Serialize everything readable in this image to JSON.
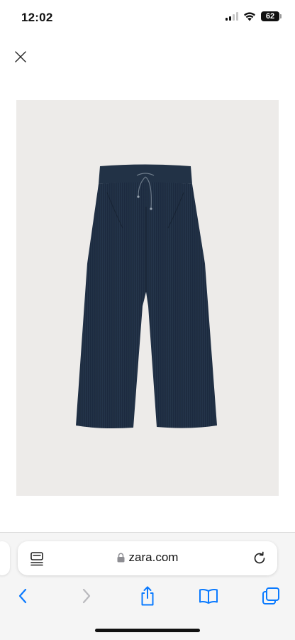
{
  "status_bar": {
    "time": "12:02",
    "battery_level": "62",
    "signal_bars_active": 2,
    "signal_bars_total": 4
  },
  "page": {
    "close_icon": "close-icon",
    "product_image": {
      "subject": "wide-leg drawstring trousers",
      "background_color": "#edebe9",
      "fabric_color": "#1c2a3a"
    }
  },
  "browser": {
    "url": "zara.com",
    "secure": true,
    "icons": {
      "page_menu": "page-menu-icon",
      "lock": "lock-icon",
      "reload": "reload-icon",
      "back": "back-icon",
      "forward": "forward-icon",
      "share": "share-icon",
      "bookmarks": "bookmarks-icon",
      "tabs": "tabs-icon"
    },
    "colors": {
      "accent": "#0a7aff",
      "disabled": "#b9b9bd"
    }
  }
}
